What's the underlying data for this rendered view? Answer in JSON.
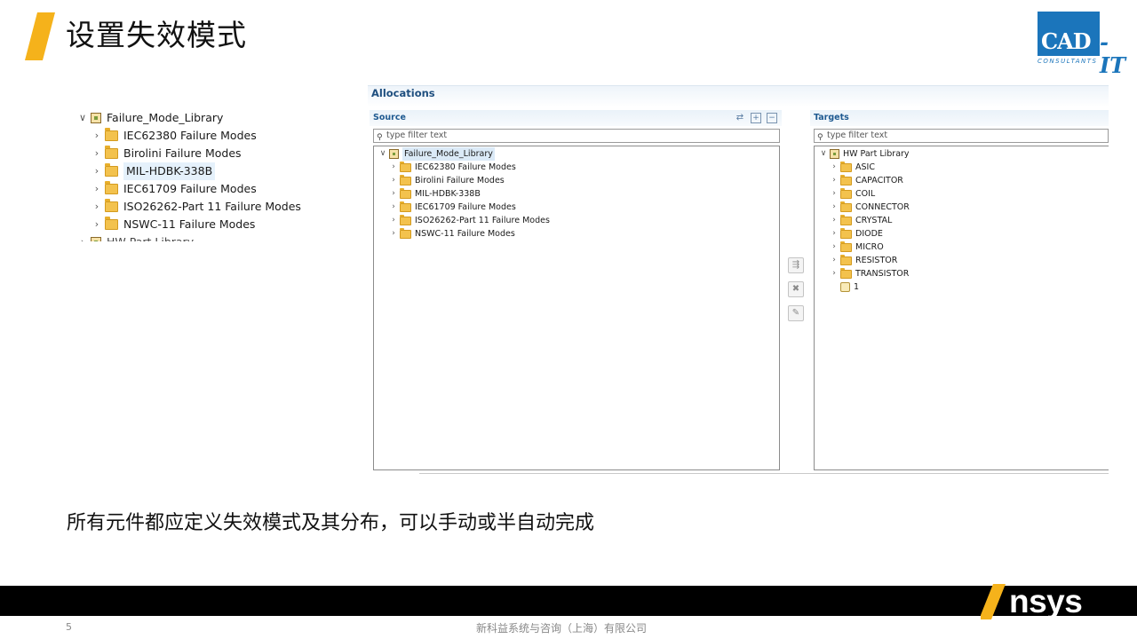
{
  "slide": {
    "title": "设置失效模式",
    "caption": "所有元件都应定义失效模式及其分布，可以手动或半自动完成",
    "page_number": "5",
    "company": "新科益系统与咨询（上海）有限公司",
    "accent_color": "#f5b21b"
  },
  "logo": {
    "cad": "CAD",
    "it": "-IT",
    "sub": "CONSULTANTS",
    "color": "#1b75bb"
  },
  "brand": {
    "name": "Ansys",
    "name_rest": "nsys",
    "accent": "#f5b21b"
  },
  "left_tree": {
    "root": "Failure_Mode_Library",
    "items": [
      "IEC62380 Failure Modes",
      "Birolini Failure Modes",
      "MIL-HDBK-338B",
      "IEC61709 Failure Modes",
      "ISO26262-Part 11 Failure Modes",
      "NSWC-11 Failure Modes"
    ],
    "selected_index": 2,
    "next_root_partial": "HW Part Library"
  },
  "allocations": {
    "title": "Allocations",
    "source": {
      "label": "Source",
      "filter_placeholder": "type filter text",
      "root": "Failure_Mode_Library",
      "items": [
        "IEC62380 Failure Modes",
        "Birolini Failure Modes",
        "MIL-HDBK-338B",
        "IEC61709 Failure Modes",
        "ISO26262-Part 11 Failure Modes",
        "NSWC-11 Failure Modes"
      ]
    },
    "targets": {
      "label": "Targets",
      "filter_placeholder": "type filter text",
      "root": "HW Part Library",
      "items": [
        "ASIC",
        "CAPACITOR",
        "COIL",
        "CONNECTOR",
        "CRYSTAL",
        "DIODE",
        "MICRO",
        "RESISTOR",
        "TRANSISTOR"
      ],
      "leaf": "1"
    }
  }
}
